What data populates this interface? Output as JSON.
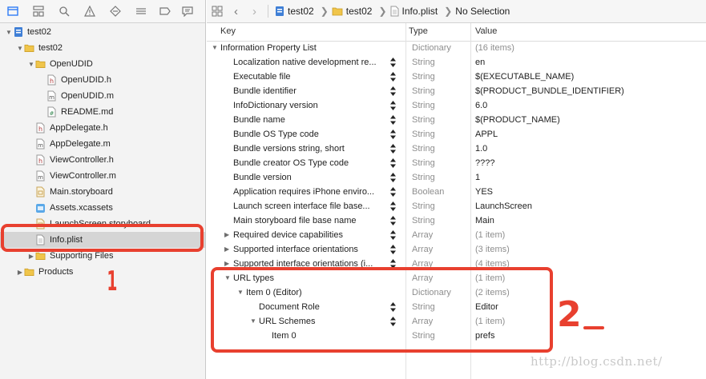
{
  "navigator": {
    "tree": [
      {
        "label": "test02",
        "icon": "project-icon",
        "indent": 0,
        "disclosure": "open"
      },
      {
        "label": "test02",
        "icon": "folder-icon",
        "indent": 1,
        "disclosure": "open"
      },
      {
        "label": "OpenUDID",
        "icon": "folder-icon",
        "indent": 2,
        "disclosure": "open"
      },
      {
        "label": "OpenUDID.h",
        "icon": "header-file-icon",
        "indent": 3,
        "disclosure": ""
      },
      {
        "label": "OpenUDID.m",
        "icon": "source-file-icon",
        "indent": 3,
        "disclosure": ""
      },
      {
        "label": "README.md",
        "icon": "markdown-file-icon",
        "indent": 3,
        "disclosure": ""
      },
      {
        "label": "AppDelegate.h",
        "icon": "header-file-icon",
        "indent": 2,
        "disclosure": ""
      },
      {
        "label": "AppDelegate.m",
        "icon": "source-file-icon",
        "indent": 2,
        "disclosure": ""
      },
      {
        "label": "ViewController.h",
        "icon": "header-file-icon",
        "indent": 2,
        "disclosure": ""
      },
      {
        "label": "ViewController.m",
        "icon": "source-file-icon",
        "indent": 2,
        "disclosure": ""
      },
      {
        "label": "Main.storyboard",
        "icon": "storyboard-icon",
        "indent": 2,
        "disclosure": ""
      },
      {
        "label": "Assets.xcassets",
        "icon": "assets-icon",
        "indent": 2,
        "disclosure": ""
      },
      {
        "label": "LaunchScreen.storyboard",
        "icon": "storyboard-icon",
        "indent": 2,
        "disclosure": ""
      },
      {
        "label": "Info.plist",
        "icon": "plist-file-icon",
        "indent": 2,
        "disclosure": "",
        "selected": true
      },
      {
        "label": "Supporting Files",
        "icon": "folder-icon",
        "indent": 2,
        "disclosure": "closed"
      },
      {
        "label": "Products",
        "icon": "folder-icon",
        "indent": 1,
        "disclosure": "closed"
      }
    ]
  },
  "jumpbar": {
    "crumbs": [
      "test02",
      "test02",
      "Info.plist",
      "No Selection"
    ]
  },
  "table": {
    "headers": {
      "key": "Key",
      "type": "Type",
      "value": "Value"
    },
    "rows": [
      {
        "key": "Information Property List",
        "type": "Dictionary",
        "value": "(16 items)",
        "level": 0,
        "disc": "open",
        "stepper": false,
        "greyval": true
      },
      {
        "key": "Localization native development re...",
        "type": "String",
        "value": "en",
        "level": 1,
        "disc": "",
        "stepper": true
      },
      {
        "key": "Executable file",
        "type": "String",
        "value": "$(EXECUTABLE_NAME)",
        "level": 1,
        "disc": "",
        "stepper": true
      },
      {
        "key": "Bundle identifier",
        "type": "String",
        "value": "$(PRODUCT_BUNDLE_IDENTIFIER)",
        "level": 1,
        "disc": "",
        "stepper": true
      },
      {
        "key": "InfoDictionary version",
        "type": "String",
        "value": "6.0",
        "level": 1,
        "disc": "",
        "stepper": true
      },
      {
        "key": "Bundle name",
        "type": "String",
        "value": "$(PRODUCT_NAME)",
        "level": 1,
        "disc": "",
        "stepper": true
      },
      {
        "key": "Bundle OS Type code",
        "type": "String",
        "value": "APPL",
        "level": 1,
        "disc": "",
        "stepper": true
      },
      {
        "key": "Bundle versions string, short",
        "type": "String",
        "value": "1.0",
        "level": 1,
        "disc": "",
        "stepper": true
      },
      {
        "key": "Bundle creator OS Type code",
        "type": "String",
        "value": "????",
        "level": 1,
        "disc": "",
        "stepper": true
      },
      {
        "key": "Bundle version",
        "type": "String",
        "value": "1",
        "level": 1,
        "disc": "",
        "stepper": true
      },
      {
        "key": "Application requires iPhone enviro...",
        "type": "Boolean",
        "value": "YES",
        "level": 1,
        "disc": "",
        "stepper": true
      },
      {
        "key": "Launch screen interface file base...",
        "type": "String",
        "value": "LaunchScreen",
        "level": 1,
        "disc": "",
        "stepper": true
      },
      {
        "key": "Main storyboard file base name",
        "type": "String",
        "value": "Main",
        "level": 1,
        "disc": "",
        "stepper": true
      },
      {
        "key": "Required device capabilities",
        "type": "Array",
        "value": "(1 item)",
        "level": 1,
        "disc": "closed",
        "stepper": true,
        "greyval": true
      },
      {
        "key": "Supported interface orientations",
        "type": "Array",
        "value": "(3 items)",
        "level": 1,
        "disc": "closed",
        "stepper": true,
        "greyval": true
      },
      {
        "key": "Supported interface orientations (i...",
        "type": "Array",
        "value": "(4 items)",
        "level": 1,
        "disc": "closed",
        "stepper": true,
        "greyval": true
      },
      {
        "key": "URL types",
        "type": "Array",
        "value": "(1 item)",
        "level": 1,
        "disc": "open",
        "stepper": false,
        "greyval": true
      },
      {
        "key": "Item 0 (Editor)",
        "type": "Dictionary",
        "value": "(2 items)",
        "level": 2,
        "disc": "open",
        "stepper": false,
        "greyval": true
      },
      {
        "key": "Document Role",
        "type": "String",
        "value": "Editor",
        "level": 3,
        "disc": "",
        "stepper": true
      },
      {
        "key": "URL Schemes",
        "type": "Array",
        "value": "(1 item)",
        "level": 3,
        "disc": "open",
        "stepper": true,
        "greyval": true
      },
      {
        "key": "Item 0",
        "type": "String",
        "value": "prefs",
        "level": 4,
        "disc": "",
        "stepper": false
      }
    ]
  },
  "annotations": {
    "label1": "1",
    "label2": "2",
    "color": "#e8402f"
  },
  "watermark": "http://blog.csdn.net/"
}
